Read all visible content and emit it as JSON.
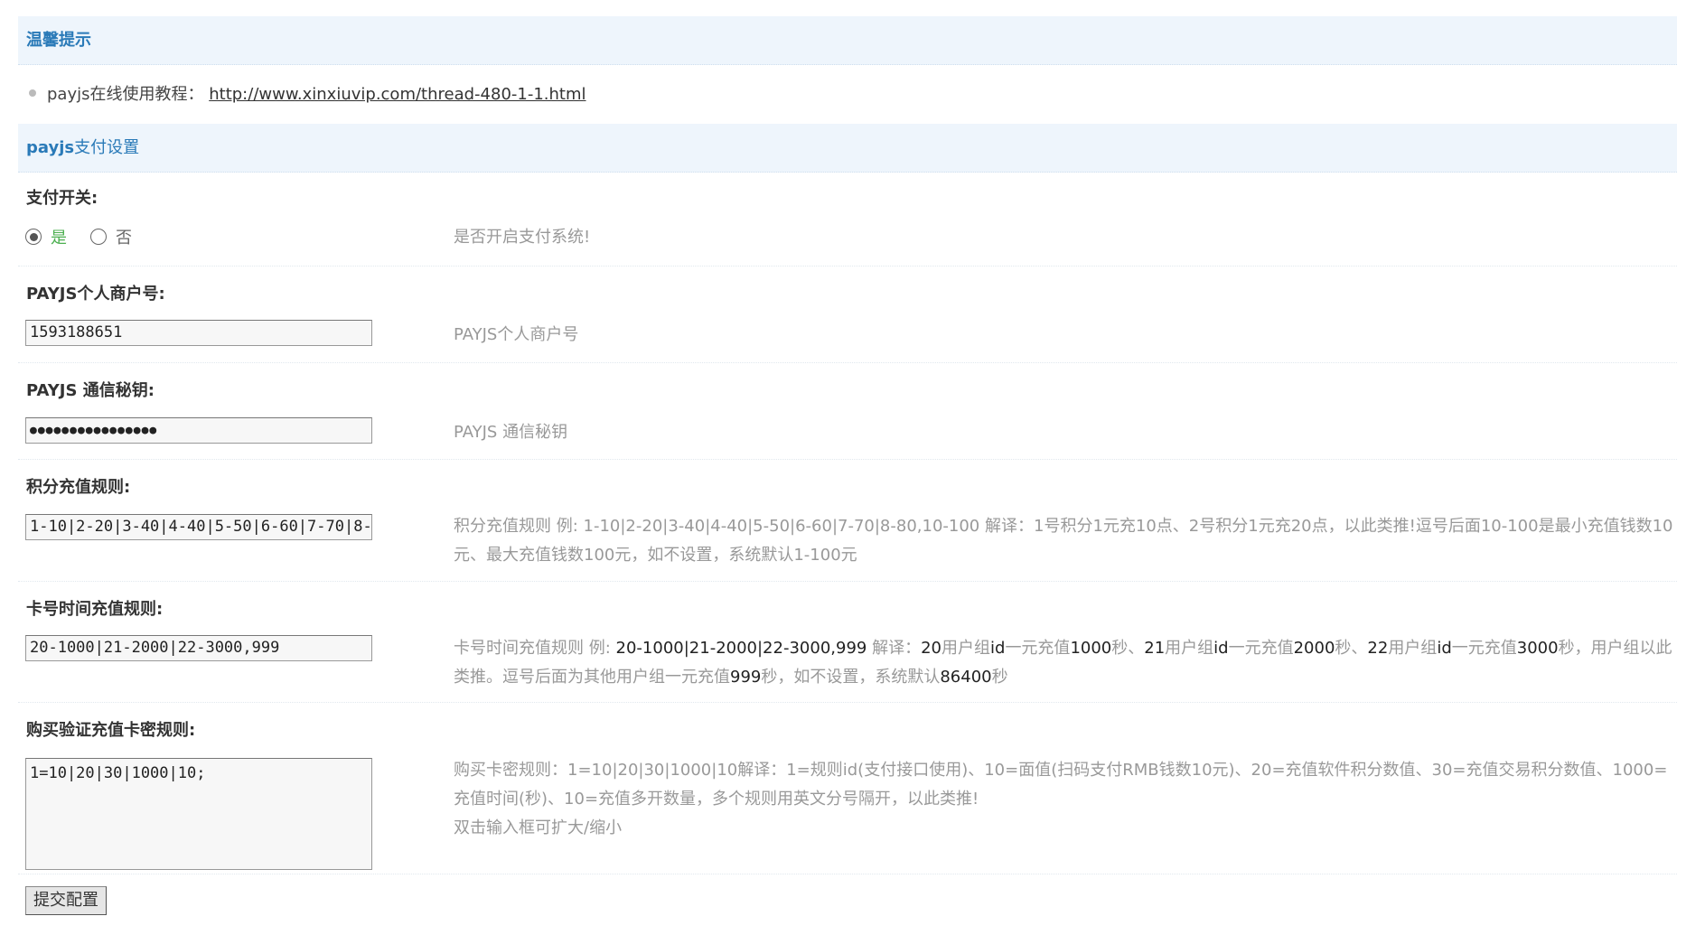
{
  "tips_section": {
    "title": "温馨提示",
    "item_prefix": "payjs在线使用教程：",
    "item_link": "http://www.xinxiuvip.com/thread-480-1-1.html"
  },
  "settings_section": {
    "title_bold": "payjs",
    "title_rest": "支付设置"
  },
  "fields": {
    "pay_switch": {
      "label": "支付开关:",
      "yes_label": "是",
      "no_label": "否",
      "selected": "yes",
      "desc": "是否开启支付系统!"
    },
    "mch_id": {
      "label": "PAYJS个人商户号:",
      "value": "1593188651",
      "desc": "PAYJS个人商户号"
    },
    "secret": {
      "label": "PAYJS 通信秘钥:",
      "value": "●●●●●●●●●●●●●●●●",
      "desc": "PAYJS 通信秘钥"
    },
    "points_rule": {
      "label": "积分充值规则:",
      "value": "1-10|2-20|3-40|4-40|5-50|6-60|7-70|8-",
      "desc_a": "积分充值规则 例: ",
      "desc_b": "1-10|2-20|3-40|4-40|5-50|6-60|7-70|8-80,10-100",
      "desc_c": " 解译：1号积分1元充10点、2号积分1元充20点，以此类推!逗号后面10-100是最小充值钱数10元、最大充值钱数100元，如不设置，系统默认1-100元"
    },
    "card_time_rule": {
      "label": "卡号时间充值规则:",
      "value": "20-1000|21-2000|22-3000,999",
      "desc_a": "卡号时间充值规则 例: ",
      "desc_b": "20-1000|21-2000|22-3000,999",
      "desc_c": " 解译：",
      "desc_d": "20",
      "desc_e": "用户组",
      "desc_f": "id",
      "desc_g": "一元充值",
      "desc_h": "1000",
      "desc_i": "秒、",
      "desc_j": "21",
      "desc_k": "用户组",
      "desc_l": "id",
      "desc_m": "一元充值",
      "desc_n": "2000",
      "desc_o": "秒、",
      "desc_p": "22",
      "desc_q": "用户组",
      "desc_r": "id",
      "desc_s": "一元充值",
      "desc_t": "3000",
      "desc_u": "秒，用户组以此类推。逗号后面为其他用户组一元充值",
      "desc_v": "999",
      "desc_w": "秒，如不设置，系统默认",
      "desc_x": "86400",
      "desc_y": "秒"
    },
    "card_buy_rule": {
      "label": "购买验证充值卡密规则:",
      "value": "1=10|20|30|1000|10;",
      "desc_line1": "购买卡密规则：1=10|20|30|1000|10解译：1=规则id(支付接口使用)、10=面值(扫码支付RMB钱数10元)、20=充值软件积分数值、30=充值交易积分数值、1000=充值时间(秒)、10=充值多开数量，多个规则用英文分号隔开，以此类推!",
      "desc_line2": "双击输入框可扩大/缩小"
    }
  },
  "submit_label": "提交配置"
}
